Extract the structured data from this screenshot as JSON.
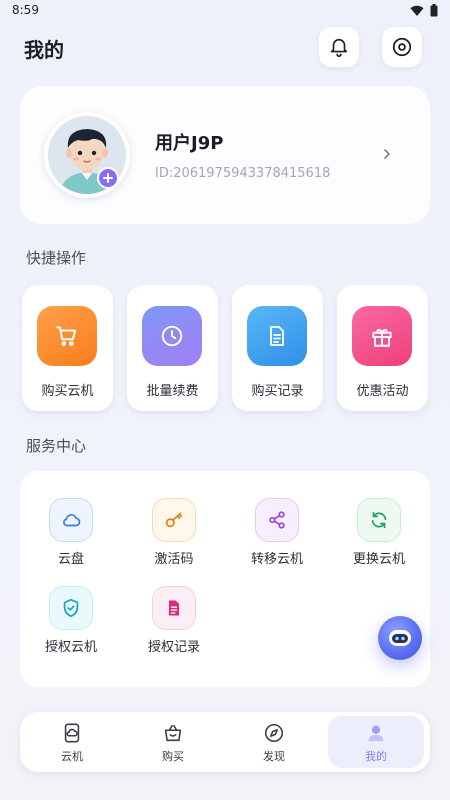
{
  "status_bar": {
    "time": "8:59"
  },
  "header": {
    "title": "我的"
  },
  "profile": {
    "name": "用户J9P",
    "id_text": "ID:2061975943378415618"
  },
  "sections": {
    "quick_title": "快捷操作",
    "service_title": "服务中心"
  },
  "quick_actions": [
    {
      "label": "购买云机",
      "icon": "cart-icon",
      "color": "#fb8a2e"
    },
    {
      "label": "批量续费",
      "icon": "clock-icon",
      "color": "#8f86f5"
    },
    {
      "label": "购买记录",
      "icon": "document-icon",
      "color": "#3ea6f0"
    },
    {
      "label": "优惠活动",
      "icon": "gift-icon",
      "color": "#f24f8a"
    }
  ],
  "services": [
    {
      "label": "云盘",
      "icon": "cloud-icon",
      "color": "#3c7be8"
    },
    {
      "label": "激活码",
      "icon": "key-icon",
      "color": "#e0841e"
    },
    {
      "label": "转移云机",
      "icon": "share-icon",
      "color": "#a044d8"
    },
    {
      "label": "更换云机",
      "icon": "refresh-icon",
      "color": "#21a35a"
    },
    {
      "label": "授权云机",
      "icon": "shield-check-icon",
      "color": "#14a7bf"
    },
    {
      "label": "授权记录",
      "icon": "record-icon",
      "color": "#e0287a"
    }
  ],
  "tabbar": [
    {
      "label": "云机",
      "icon": "cloud-phone-icon",
      "active": false
    },
    {
      "label": "购买",
      "icon": "shopping-bag-icon",
      "active": false
    },
    {
      "label": "发现",
      "icon": "compass-icon",
      "active": false
    },
    {
      "label": "我的",
      "icon": "user-icon",
      "active": true
    }
  ],
  "colors": {
    "accent": "#8a7cf0",
    "background": "#eef1fb"
  }
}
